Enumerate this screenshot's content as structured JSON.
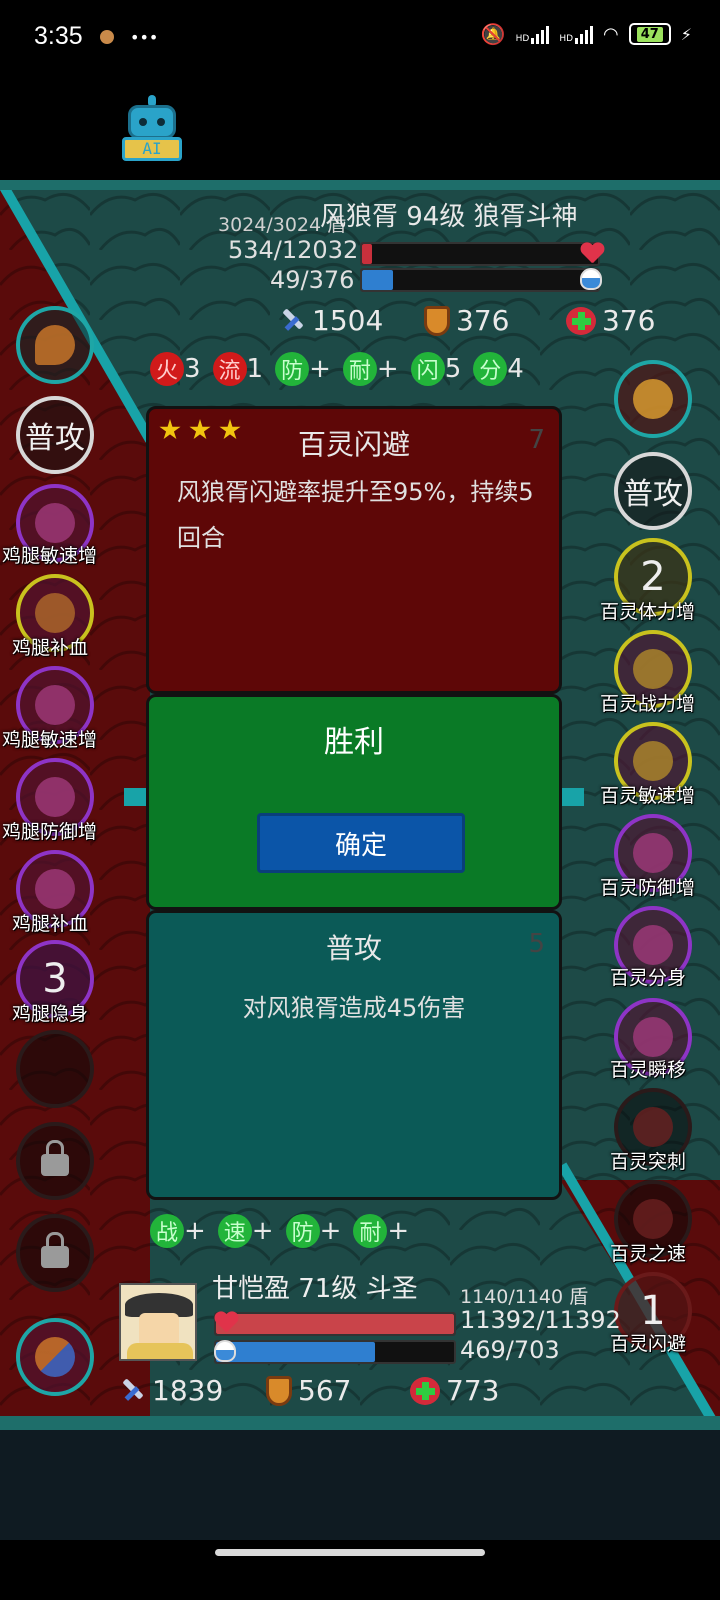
{
  "status_bar": {
    "time": "3:35",
    "dots": "•••",
    "net1": "HD",
    "net2": "HD",
    "battery": "47"
  },
  "ai_button": {
    "label": "AI"
  },
  "enemy": {
    "name_line": "风狼胥 94级 狼胥斗神",
    "shield": "3024/3024 盾",
    "hp": "534/12032",
    "hp_fraction": 0.044,
    "mp": "49/376",
    "mp_fraction": 0.13,
    "attack": "1504",
    "defense": "376",
    "heal": "376",
    "buffs": [
      {
        "badge": "火",
        "value": "3",
        "color": "red"
      },
      {
        "badge": "流",
        "value": "1",
        "color": "red"
      },
      {
        "badge": "防",
        "value": "+",
        "color": "green"
      },
      {
        "badge": "耐",
        "value": "+",
        "color": "green"
      },
      {
        "badge": "闪",
        "value": "5",
        "color": "green"
      },
      {
        "badge": "分",
        "value": "4",
        "color": "green"
      }
    ]
  },
  "left_skills": [
    {
      "label": "普攻",
      "caption": ""
    },
    {
      "caption": "鸡腿敏速增"
    },
    {
      "caption": "鸡腿补血"
    },
    {
      "caption": "鸡腿敏速增"
    },
    {
      "caption": "鸡腿防御增"
    },
    {
      "caption": "鸡腿补血"
    },
    {
      "num": "3",
      "caption": "鸡腿隐身"
    }
  ],
  "right_skills": [
    {
      "label": "普攻"
    },
    {
      "num": "2",
      "caption": "百灵体力增"
    },
    {
      "caption": "百灵战力增"
    },
    {
      "caption": "百灵敏速增"
    },
    {
      "caption": "百灵防御增"
    },
    {
      "caption": "百灵分身"
    },
    {
      "caption": "百灵瞬移"
    },
    {
      "caption": "百灵突刺"
    },
    {
      "caption": "百灵之速"
    },
    {
      "num": "1",
      "caption": "百灵闪避"
    }
  ],
  "card_enemy": {
    "title": "百灵闪避",
    "count": "7",
    "description": "风狼胥闪避率提升至95%，持续5回合",
    "stars": 3
  },
  "result_panel": {
    "title": "胜利",
    "confirm_label": "确定"
  },
  "card_player": {
    "title": "普攻",
    "count": "5",
    "description": "对风狼胥造成45伤害"
  },
  "player": {
    "buffs": [
      {
        "badge": "战",
        "value": "+"
      },
      {
        "badge": "速",
        "value": "+"
      },
      {
        "badge": "防",
        "value": "+"
      },
      {
        "badge": "耐",
        "value": "+"
      }
    ],
    "name_line": "甘恺盈 71级 斗圣",
    "shield": "1140/1140 盾",
    "hp": "11392/11392",
    "hp_fraction": 1.0,
    "mp": "469/703",
    "mp_fraction": 0.667,
    "attack": "1839",
    "defense": "567",
    "heal": "773"
  },
  "colors": {
    "accent_teal": "#18a3a8",
    "left_zone": "#5a0b0b",
    "right_zone": "#1d4a47"
  }
}
